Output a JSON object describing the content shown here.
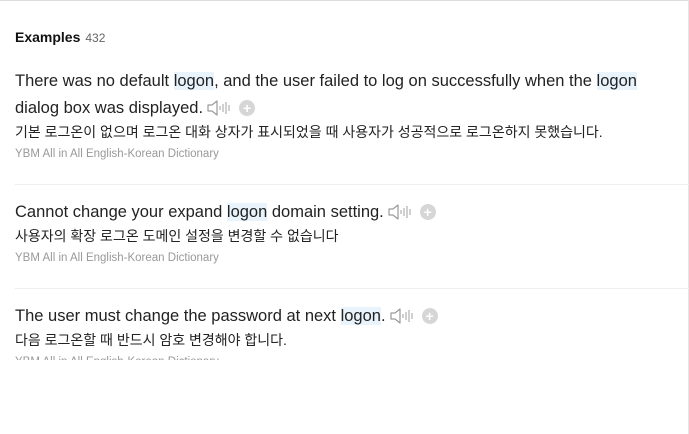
{
  "header": {
    "title": "Examples",
    "count": "432"
  },
  "examples": [
    {
      "parts": [
        "There was no default ",
        "logon",
        ", and the user failed to log on successfully when the ",
        "logon",
        " dialog box was displayed."
      ],
      "translation": "기본 로그온이 없으며 로그온 대화 상자가 표시되었을 때 사용자가 성공적으로 로그온하지 못했습니다.",
      "source": "YBM All in All English-Korean Dictionary"
    },
    {
      "parts": [
        "Cannot change your expand ",
        "logon",
        " domain setting."
      ],
      "translation": "사용자의 확장 로그온 도메인 설정을 변경할 수 없습니다",
      "source": "YBM All in All English-Korean Dictionary"
    },
    {
      "parts": [
        "The user must change the password at next ",
        "logon",
        "."
      ],
      "translation": "다음 로그온할 때 반드시 암호 변경해야 합니다.",
      "source": "YBM All in All English-Korean Dictionary"
    }
  ],
  "icons": {
    "speaker": "speaker-icon",
    "add": "plus-icon",
    "add_glyph": "+"
  },
  "colors": {
    "highlight": "#e8f3fc",
    "source_text": "#999999",
    "icon_gray": "#d6d6d6"
  }
}
